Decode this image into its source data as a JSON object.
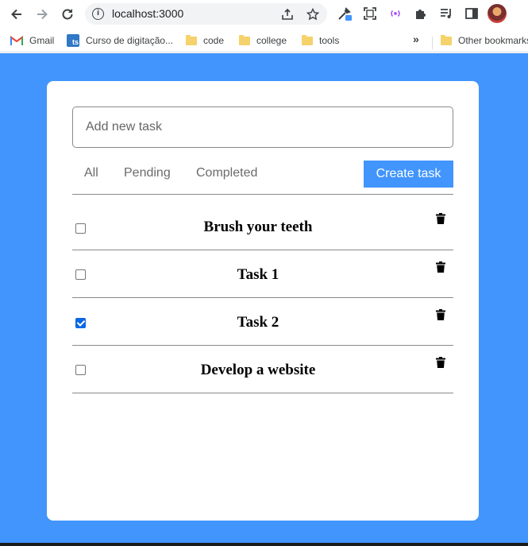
{
  "browser": {
    "url": "localhost:3000",
    "bookmarks": [
      {
        "label": "Gmail",
        "icon": "gmail-icon"
      },
      {
        "label": "Curso de digitação...",
        "icon": "typescript-icon"
      },
      {
        "label": "code",
        "icon": "folder-icon"
      },
      {
        "label": "college",
        "icon": "folder-icon"
      },
      {
        "label": "tools",
        "icon": "folder-icon"
      }
    ],
    "overflow_label": "»",
    "other_bookmarks": "Other bookmarks"
  },
  "app": {
    "input_placeholder": "Add new task",
    "filters": [
      {
        "label": "All"
      },
      {
        "label": "Pending"
      },
      {
        "label": "Completed"
      }
    ],
    "create_label": "Create task",
    "accent_color": "#4195fc",
    "tasks": [
      {
        "title": "Brush your teeth",
        "done": false
      },
      {
        "title": "Task 1",
        "done": false
      },
      {
        "title": "Task 2",
        "done": true
      },
      {
        "title": "Develop a website",
        "done": false
      }
    ]
  }
}
